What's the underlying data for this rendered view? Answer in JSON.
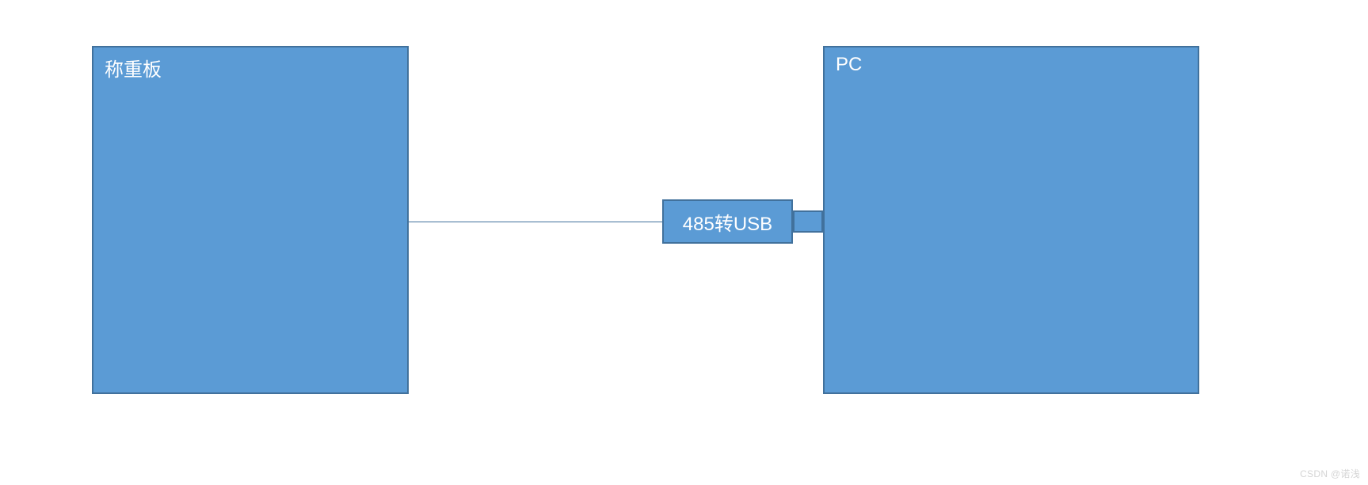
{
  "diagram": {
    "left_box_label": "称重板",
    "right_box_label": "PC",
    "adapter_label": "485转USB",
    "watermark": "CSDN @诺浅",
    "colors": {
      "fill": "#5b9bd5",
      "border": "#41719c",
      "text": "#ffffff"
    }
  }
}
